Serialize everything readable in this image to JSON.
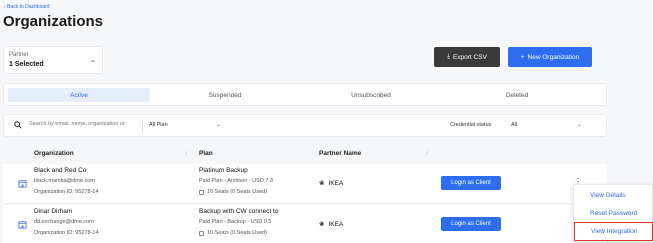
{
  "header": {
    "back_link": "‹ Back to Dashboard",
    "title": "Organizations"
  },
  "partner_filter": {
    "label": "Partner",
    "value": "1 Selected"
  },
  "actions": {
    "export_label": "Export CSV",
    "new_label": "New Organization"
  },
  "tabs": [
    {
      "label": "Active",
      "active": true
    },
    {
      "label": "Suspended",
      "active": false
    },
    {
      "label": "Unsubscribed",
      "active": false
    },
    {
      "label": "Deleted",
      "active": false
    }
  ],
  "search": {
    "placeholder": "Search by email, name, organization or",
    "plan_filter": "All Plan",
    "credential_label": "Credential status",
    "credential_value": "All"
  },
  "table": {
    "columns": [
      "Organization",
      "Plan",
      "Partner Name"
    ],
    "rows": [
      {
        "name": "Black and Red Co",
        "email": "black.mamba@dme.com",
        "org_id": "Organization ID: 95278-14",
        "plan": "Platinum Backup",
        "plan_detail": "Paid Plan - Archiver - USD 7.3",
        "seats": "16 Seats (0 Seats Used)",
        "partner": "IKEA",
        "login_label": "Login as Client"
      },
      {
        "name": "Dinar Dirham",
        "email": "dd.exchange@dme.com",
        "org_id": "Organization ID: 95278-14",
        "plan": "Backup with CW connect to",
        "plan_detail": "Paid Plan - Backup - USD 0.5",
        "seats": "10 Seats (0 Seats Used)",
        "partner": "IKEA",
        "login_label": "Login as Client"
      }
    ]
  },
  "row_menu": {
    "items": [
      "View Details",
      "Reset Password",
      "View Integration"
    ],
    "highlighted_index": 2,
    "highlight_color": "#e0362c"
  },
  "colors": {
    "accent": "#2d6ef0",
    "export_button": "#3a3a3a"
  },
  "icons": [
    "chevron-down-icon",
    "download-icon",
    "plus-icon",
    "search-icon",
    "building-icon",
    "seat-icon",
    "partner-icon",
    "more-vertical-icon"
  ]
}
